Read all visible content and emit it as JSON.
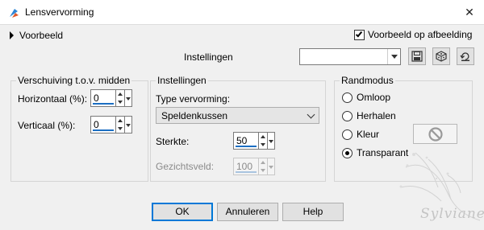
{
  "window": {
    "title": "Lensvervorming",
    "close_label": "✕"
  },
  "preview": {
    "toggle_label": "Voorbeeld",
    "checkbox_label": "Voorbeeld op afbeelding",
    "checked": true
  },
  "presets": {
    "label": "Instellingen",
    "value": ""
  },
  "offset_group": {
    "title": "Verschuiving t.o.v. midden",
    "horizontal": {
      "label": "Horizontaal (%):",
      "value": "0"
    },
    "vertical": {
      "label": "Verticaal (%):",
      "value": "0"
    }
  },
  "settings_group": {
    "title": "Instellingen",
    "type_label": "Type vervorming:",
    "type_value": "Speldenkussen",
    "strength": {
      "label": "Sterkte:",
      "value": "50"
    },
    "field_of_view": {
      "label": "Gezichtsveld:",
      "value": "100",
      "disabled": true
    }
  },
  "edge_group": {
    "title": "Randmodus",
    "options": [
      {
        "label": "Omloop",
        "selected": false
      },
      {
        "label": "Herhalen",
        "selected": false
      },
      {
        "label": "Kleur",
        "selected": false
      },
      {
        "label": "Transparant",
        "selected": true
      }
    ]
  },
  "buttons": {
    "ok": "OK",
    "cancel": "Annuleren",
    "help": "Help"
  },
  "watermark": {
    "text": "Sylviane"
  },
  "icons": {
    "app": "app-palette-icon",
    "save": "save-preset-icon",
    "random": "randomize-dice-icon",
    "reset": "reset-default-icon",
    "no_color": "no-color-icon"
  },
  "colors": {
    "accent": "#0078d7",
    "spin_underline": "#1b6ec2",
    "background": "#f0f0f0"
  }
}
